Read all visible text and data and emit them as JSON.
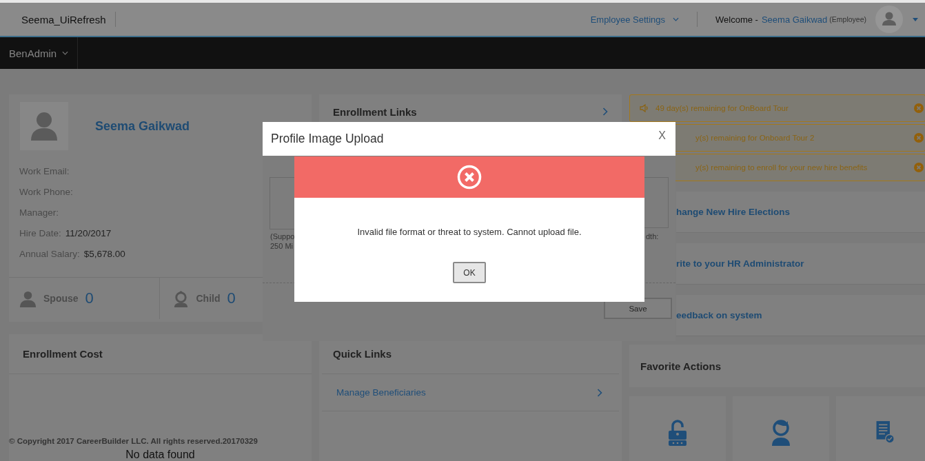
{
  "header": {
    "app_name": "Seema_UiRefresh",
    "settings_menu": "Employee Settings",
    "welcome_label": "Welcome -",
    "user_name": "Seema Gaikwad",
    "user_role": "(Employee)"
  },
  "nav": {
    "menu": "BenAdmin"
  },
  "profile": {
    "name": "Seema Gaikwad",
    "fields": [
      {
        "label": "Work Email:"
      },
      {
        "label": "Work Phone:"
      },
      {
        "label": "Manager:"
      },
      {
        "label": "Hire Date:",
        "value": "11/20/2017"
      },
      {
        "label": "Annual Salary:",
        "value": "$5,678.00"
      }
    ],
    "dependents": [
      {
        "kind": "adult",
        "label": "Spouse",
        "count": "0"
      },
      {
        "kind": "child",
        "label": "Child",
        "count": "0"
      }
    ]
  },
  "enrollment_links": {
    "title": "Enrollment Links"
  },
  "alerts": [
    {
      "text": "49 day(s) remaining for OnBoard Tour",
      "speaker_icon": true
    },
    {
      "text": "y(s) remaining for Onboard Tour 2",
      "speaker_icon": false
    },
    {
      "text": "y(s) remaining to enroll for your new hire benefits",
      "speaker_icon": false
    }
  ],
  "actions": [
    "hange New Hire Elections",
    "rite to your HR Administrator",
    "eedback on system"
  ],
  "enrollment_cost": {
    "title": "Enrollment Cost",
    "empty_text": "No data found"
  },
  "quick_links": {
    "title": "Quick Links",
    "links": [
      "Manage Beneficiaries"
    ]
  },
  "favorite_actions": {
    "title": "Favorite Actions",
    "tiles": [
      {
        "kind": "unlock"
      },
      {
        "kind": "user-refresh"
      },
      {
        "kind": "document-check"
      }
    ]
  },
  "footer": {
    "copyright": "© Copyright 2017 CareerBuilder LLC. All rights reserved.20170329"
  },
  "upload_dialog": {
    "title": "Profile Image Upload",
    "close": "X",
    "note_left": [
      "(Suppo",
      "250 Mi"
    ],
    "note_right": "dth:",
    "save_button": "Save"
  },
  "error_dialog": {
    "message": "Invalid file format or threat to system. Cannot upload file.",
    "ok_button": "OK"
  }
}
